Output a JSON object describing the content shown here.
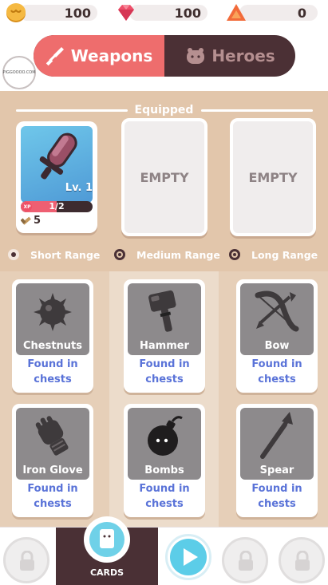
{
  "currencies": [
    {
      "name": "coins",
      "value": "100",
      "icon": "coin-icon",
      "color": "#f5b942"
    },
    {
      "name": "gems",
      "value": "100",
      "icon": "gem-icon",
      "color": "#ee4f6a"
    },
    {
      "name": "tickets",
      "value": "0",
      "icon": "triangle-icon",
      "color": "#f26b3a"
    }
  ],
  "tabs": {
    "weapons": "Weapons",
    "heroes": "Heroes"
  },
  "sponsor": {
    "text": "PIGGOOOO.COM"
  },
  "equipped": {
    "title": "Equipped",
    "weapon": {
      "level": "Lv. 1",
      "xp_label": "XP",
      "xp": "1/2",
      "xp_fraction": 0.5,
      "count": "5"
    },
    "empty1": "EMPTY",
    "empty2": "EMPTY"
  },
  "ranges": [
    "Short Range",
    "Medium Range",
    "Long Range"
  ],
  "items": [
    {
      "name": "Chestnuts",
      "line1": "Found in",
      "line2": "chests"
    },
    {
      "name": "Hammer",
      "line1": "Found in",
      "line2": "chests"
    },
    {
      "name": "Bow",
      "line1": "Found in",
      "line2": "chests"
    },
    {
      "name": "Iron Glove",
      "line1": "Found in",
      "line2": "chests"
    },
    {
      "name": "Bombs",
      "line1": "Found in",
      "line2": "chests"
    },
    {
      "name": "Spear",
      "line1": "Found in",
      "line2": "chests"
    }
  ],
  "bottom_nav": {
    "cards_label": "CARDS"
  },
  "colors": {
    "accent": "#ee6d6d",
    "dark": "#4a3035",
    "found_text": "#5a73d8",
    "play": "#5ccde8"
  }
}
